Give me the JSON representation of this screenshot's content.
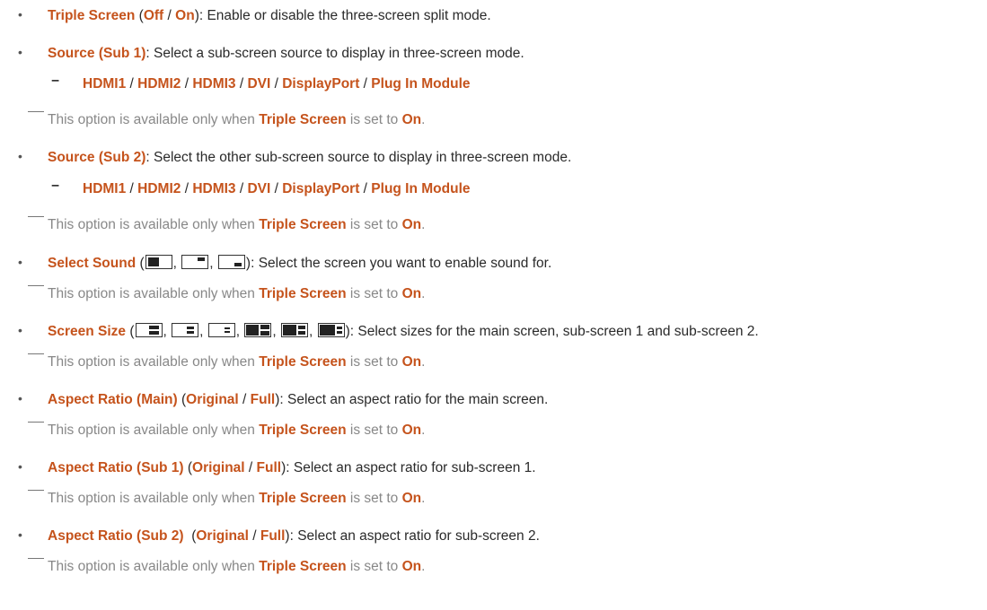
{
  "triple_screen": {
    "label": "Triple Screen",
    "opt_off": "Off",
    "sep": "/",
    "opt_on": "On",
    "desc": ": Enable or disable the three-screen split mode."
  },
  "source_sub1": {
    "label": "Source (Sub 1)",
    "desc": ": Select a sub-screen source to display in three-screen mode."
  },
  "source_sub2": {
    "label": "Source (Sub 2)",
    "desc": ": Select the other sub-screen source to display in three-screen mode."
  },
  "sources": [
    "HDMI1",
    "HDMI2",
    "HDMI3",
    "DVI",
    "DisplayPort",
    "Plug In Module"
  ],
  "note": {
    "prefix": "This option is available only when ",
    "bold": "Triple Screen",
    "middle": " is set to ",
    "on": "On",
    "end": "."
  },
  "select_sound": {
    "label": "Select Sound",
    "desc": ": Select the screen you want to enable sound for.",
    "icons": [
      "sound-main-icon",
      "sound-sub1-icon",
      "sound-sub2-icon"
    ]
  },
  "screen_size": {
    "label": "Screen Size",
    "desc": ": Select sizes for the main screen, sub-screen 1 and sub-screen 2.",
    "icons": [
      "size-1-icon",
      "size-2-icon",
      "size-3-icon",
      "size-4-icon",
      "size-5-icon",
      "size-6-icon"
    ]
  },
  "aspect_main": {
    "label": "Aspect Ratio (Main)",
    "opt_original": "Original",
    "opt_full": "Full",
    "desc": ": Select an aspect ratio for the main screen."
  },
  "aspect_sub1": {
    "label": "Aspect Ratio (Sub 1)",
    "opt_original": "Original",
    "opt_full": "Full",
    "desc": ": Select an aspect ratio for sub-screen 1."
  },
  "aspect_sub2": {
    "label": "Aspect Ratio (Sub 2)",
    "opt_original": "Original",
    "opt_full": "Full",
    "desc": ": Select an aspect ratio for sub-screen 2."
  },
  "colors": {
    "accent": "#c5531c",
    "note": "#888888",
    "text": "#2a2a2a"
  }
}
